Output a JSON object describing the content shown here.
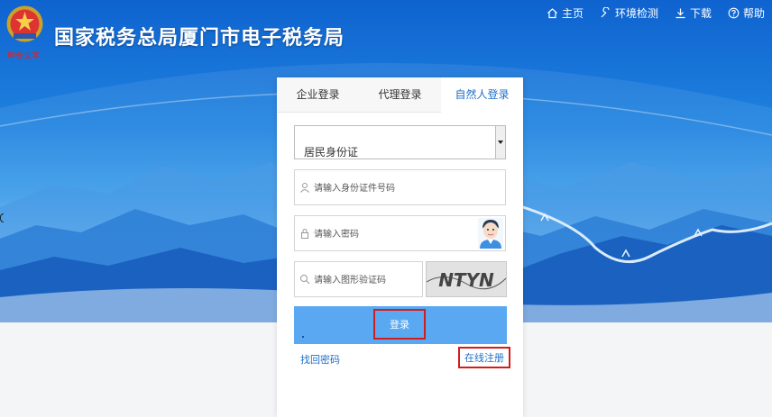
{
  "header": {
    "title": "国家税务总局厦门市电子税务局",
    "signature": "甲骨文字"
  },
  "topnav": [
    {
      "label": "主页",
      "icon": "home-icon"
    },
    {
      "label": "环境检测",
      "icon": "wrench-icon"
    },
    {
      "label": "下载",
      "icon": "download-icon"
    },
    {
      "label": "帮助",
      "icon": "help-icon"
    }
  ],
  "login": {
    "tabs": [
      {
        "label": "企业登录",
        "active": false
      },
      {
        "label": "代理登录",
        "active": false
      },
      {
        "label": "自然人登录",
        "active": true
      }
    ],
    "id_type": {
      "selected": "居民身份证"
    },
    "id_number": {
      "placeholder": "请输入身份证件号码",
      "value": ""
    },
    "password": {
      "placeholder": "请输入密码",
      "value": ""
    },
    "captcha": {
      "placeholder": "请输入图形验证码",
      "value": "",
      "image_text": "NTYN"
    },
    "login_button": "登录",
    "forgot_link": "找回密码",
    "register_link": "在线注册"
  },
  "colors": {
    "accent": "#1e6fc8",
    "button_bg": "#5aa8f2",
    "highlight_border": "#d21d1d"
  }
}
